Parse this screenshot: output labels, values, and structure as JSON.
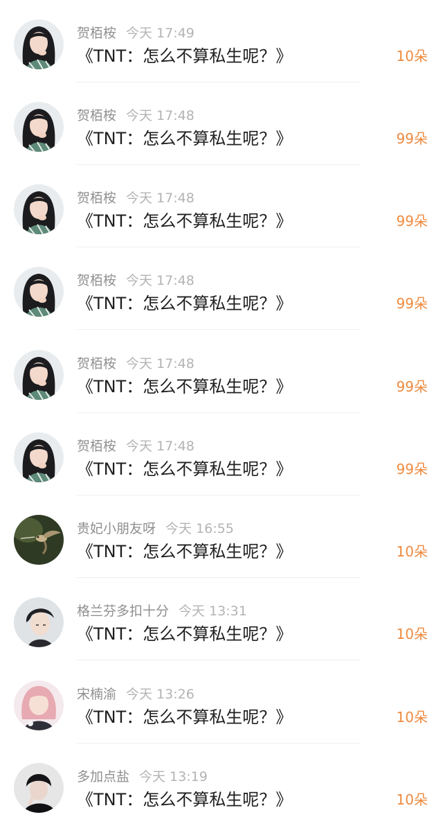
{
  "comments": [
    {
      "username": "贺栢桉",
      "time": "今天 17:49",
      "message": "《TNT：怎么不算私生呢？》",
      "gift": "10朵",
      "avatar": "girl-avatar"
    },
    {
      "username": "贺栢桉",
      "time": "今天 17:48",
      "message": "《TNT：怎么不算私生呢？》",
      "gift": "99朵",
      "avatar": "girl-avatar"
    },
    {
      "username": "贺栢桉",
      "time": "今天 17:48",
      "message": "《TNT：怎么不算私生呢？》",
      "gift": "99朵",
      "avatar": "girl-avatar"
    },
    {
      "username": "贺栢桉",
      "time": "今天 17:48",
      "message": "《TNT：怎么不算私生呢？》",
      "gift": "99朵",
      "avatar": "girl-avatar"
    },
    {
      "username": "贺栢桉",
      "time": "今天 17:48",
      "message": "《TNT：怎么不算私生呢？》",
      "gift": "99朵",
      "avatar": "girl-avatar"
    },
    {
      "username": "贺栢桉",
      "time": "今天 17:48",
      "message": "《TNT：怎么不算私生呢？》",
      "gift": "99朵",
      "avatar": "girl-avatar"
    },
    {
      "username": "贵妃小朋友呀",
      "time": "今天 16:55",
      "message": "《TNT：怎么不算私生呢？》",
      "gift": "10朵",
      "avatar": "hummingbird-avatar"
    },
    {
      "username": "格兰芬多扣十分",
      "time": "今天 13:31",
      "message": "《TNT：怎么不算私生呢？》",
      "gift": "10朵",
      "avatar": "boy-avatar"
    },
    {
      "username": "宋楠渝",
      "time": "今天 13:26",
      "message": "《TNT：怎么不算私生呢？》",
      "gift": "10朵",
      "avatar": "pink-hair-avatar"
    },
    {
      "username": "多加点盐",
      "time": "今天 13:19",
      "message": "《TNT：怎么不算私生呢？》",
      "gift": "10朵",
      "avatar": "boy-dark-avatar"
    }
  ],
  "colors": {
    "username": "#8f8f8f",
    "time": "#b3b3b3",
    "message": "#1f1f1f",
    "gift": "#ee8a3f",
    "divider": "#efefef"
  }
}
